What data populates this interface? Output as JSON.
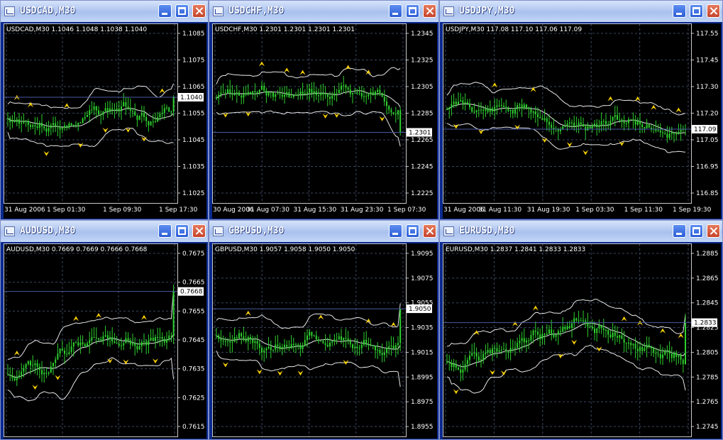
{
  "windows": [
    {
      "id": "usdcad",
      "title": "USDCAD,M30",
      "header": "USDCAD,M30  1.1046 1.1048 1.1038 1.1040",
      "price_levels": [
        "1.1085",
        "1.1075",
        "1.1065",
        "1.1055",
        "1.1045",
        "1.1035",
        "1.1025"
      ],
      "current_price": "1.1040",
      "time_labels": [
        "31 Aug 2006",
        "1 Sep 01:30",
        "1 Sep 09:30",
        "1 Sep 17:30"
      ]
    },
    {
      "id": "usdchf",
      "title": "USDCHF,M30",
      "header": "USDCHF,M30  1.2301 1.2301 1.2301 1.2301",
      "price_levels": [
        "1.2345",
        "1.2325",
        "1.2305",
        "1.2285",
        "1.2265",
        "1.2245",
        "1.2225"
      ],
      "current_price": "1.2301",
      "time_labels": [
        "30 Aug 2006",
        "31 Aug 07:30",
        "31 Aug 15:30",
        "31 Aug 23:30",
        "1 Sep 07:30"
      ]
    },
    {
      "id": "usdjpy",
      "title": "USDJPY,M30",
      "header": "USDJPY,M30  117.08 117.10 117.06 117.09",
      "price_levels": [
        "117.55",
        "117.45",
        "117.30",
        "117.20",
        "117.05",
        "116.95",
        "116.85"
      ],
      "current_price": "117.09",
      "time_labels": [
        "31 Aug 2006",
        "31 Aug 11:30",
        "31 Aug 19:30",
        "1 Sep 03:30",
        "1 Sep 11:30",
        "1 Sep 19:30"
      ]
    },
    {
      "id": "audusd",
      "title": "AUDUSD,M30",
      "header": "AUDUSD,M30  0.7669 0.7669 0.7666 0.7668",
      "price_levels": [
        "0.7675",
        "0.7665",
        "0.7655",
        "0.7645",
        "0.7635",
        "0.7625",
        "0.7615"
      ],
      "current_price": "0.7668",
      "time_labels": [
        "31 Aug 2006",
        "1 Sep 01:30",
        "1 Sep 09:30",
        "1 Sep 17:30"
      ]
    },
    {
      "id": "gbpusd",
      "title": "GBPUSD,M30",
      "header": "GBPUSD,M30  1.9057 1.9058 1.9050 1.9050",
      "price_levels": [
        "1.9095",
        "1.9075",
        "1.9055",
        "1.9035",
        "1.9015",
        "1.8995",
        "1.8975",
        "1.8955"
      ],
      "current_price": "1.9050",
      "time_labels": [
        "31 Aug 2006",
        "31 Aug 21:30",
        "1 Sep 05:30",
        "1 Sep 13:30",
        "1 Sep 21:30"
      ]
    },
    {
      "id": "eurusd",
      "title": "EURUSD,M30",
      "header": "EURUSD,M30  1.2837 1.2841 1.2833 1.2833",
      "price_levels": [
        "1.2885",
        "1.2865",
        "1.2845",
        "1.2825",
        "1.2805",
        "1.2785",
        "1.2765",
        "1.2745"
      ],
      "current_price": "1.2833",
      "time_labels": [
        "31 Aug 2006",
        "31 Aug 12:00",
        "31 Aug 20:00",
        "1 Sep 04:00",
        "1 Sep 12:00",
        "1 Sep 20:00"
      ]
    }
  ],
  "colors": {
    "candles": "#2ed12e",
    "bands": "#e6e6e6",
    "grid": "#3b4660",
    "fractal": "#ffd400",
    "price_line": "#4a5aa0",
    "titlebar": "#a9c1ee"
  },
  "icons": {
    "window": "chart-window-icon",
    "minimize": "minimize-icon",
    "maximize": "maximize-icon",
    "close": "close-icon",
    "fractal_up": "fractal-up-arrow-icon",
    "fractal_down": "fractal-down-arrow-icon"
  }
}
